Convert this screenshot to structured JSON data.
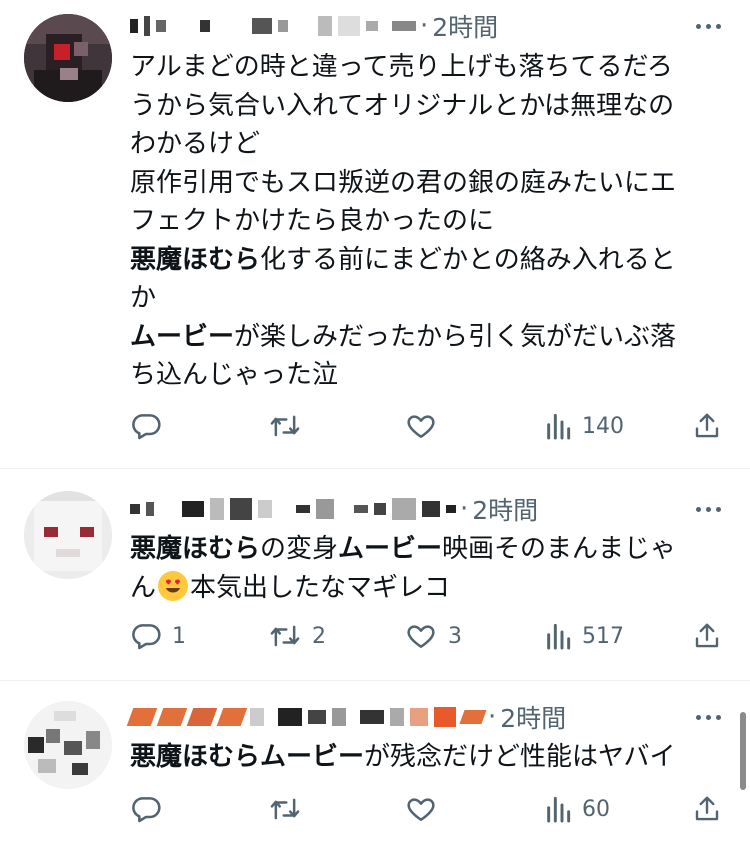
{
  "tweets": [
    {
      "time": "2時間",
      "lines": [
        {
          "segments": [
            {
              "text": "アルまどの時と違って売り上げも落ちてるだろ",
              "bold": false
            }
          ]
        },
        {
          "segments": [
            {
              "text": "うから気合い入れてオリジナルとかは無理なの",
              "bold": false
            }
          ]
        },
        {
          "segments": [
            {
              "text": "わかるけど",
              "bold": false
            }
          ]
        },
        {
          "segments": [
            {
              "text": "原作引用でもスロ叛逆の君の銀の庭みたいにエ",
              "bold": false
            }
          ]
        },
        {
          "segments": [
            {
              "text": "フェクトかけたら良かったのに",
              "bold": false
            }
          ]
        },
        {
          "segments": [
            {
              "text": "悪魔ほむら",
              "bold": true
            },
            {
              "text": "化する前にまどかとの絡み入れると",
              "bold": false
            }
          ]
        },
        {
          "segments": [
            {
              "text": "か",
              "bold": false
            }
          ]
        },
        {
          "segments": [
            {
              "text": "ムービー",
              "bold": true
            },
            {
              "text": "が楽しみだったから引く気がだいぶ落",
              "bold": false
            }
          ]
        },
        {
          "segments": [
            {
              "text": "ち込んじゃった泣",
              "bold": false
            }
          ]
        }
      ],
      "reply_count": "",
      "retweet_count": "",
      "like_count": "",
      "view_count": "140"
    },
    {
      "time": "2時間",
      "lines": [
        {
          "segments": [
            {
              "text": "悪魔ほむら",
              "bold": true
            },
            {
              "text": "の変身",
              "bold": false
            },
            {
              "text": "ムービー",
              "bold": true
            },
            {
              "text": "映画そのまんまじゃ",
              "bold": false
            }
          ]
        },
        {
          "segments": [
            {
              "text": "ん",
              "bold": false
            },
            {
              "emoji": "heart-eyes-emoji"
            },
            {
              "text": "本気出したなマギレコ",
              "bold": false
            }
          ]
        }
      ],
      "reply_count": "1",
      "retweet_count": "2",
      "like_count": "3",
      "view_count": "517"
    },
    {
      "time": "2時間",
      "lines": [
        {
          "segments": [
            {
              "text": "悪魔ほむら",
              "bold": true
            },
            {
              "text": "ムービー",
              "bold": true
            },
            {
              "text": "が残念だけど性能はヤバイ",
              "bold": false
            }
          ]
        }
      ],
      "reply_count": "",
      "retweet_count": "",
      "like_count": "",
      "view_count": "60"
    }
  ],
  "icons": {
    "reply": "reply-icon",
    "retweet": "retweet-icon",
    "like": "like-icon",
    "views": "views-icon",
    "share": "share-icon",
    "more": "more-icon"
  },
  "colors": {
    "text": "#0f1419",
    "secondary": "#536471",
    "divider": "#eff3f4"
  }
}
